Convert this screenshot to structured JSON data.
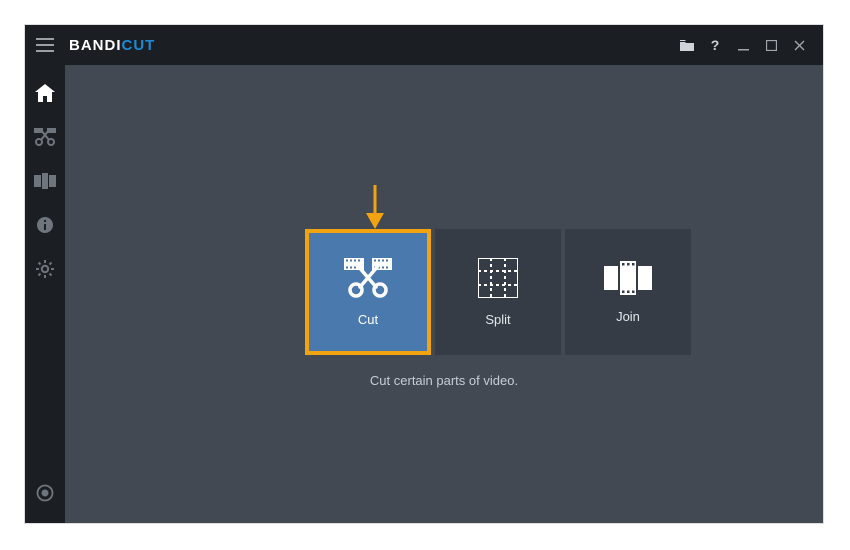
{
  "brand": {
    "part1": "BANDI",
    "part2": "CUT"
  },
  "sidebar": {
    "home": "home",
    "cut": "cut",
    "join": "join",
    "info": "info",
    "settings": "settings",
    "record": "record"
  },
  "tiles": {
    "cut": {
      "label": "Cut"
    },
    "split": {
      "label": "Split"
    },
    "join": {
      "label": "Join"
    }
  },
  "description": "Cut certain parts of video.",
  "arrow_color": "#f2a30f"
}
